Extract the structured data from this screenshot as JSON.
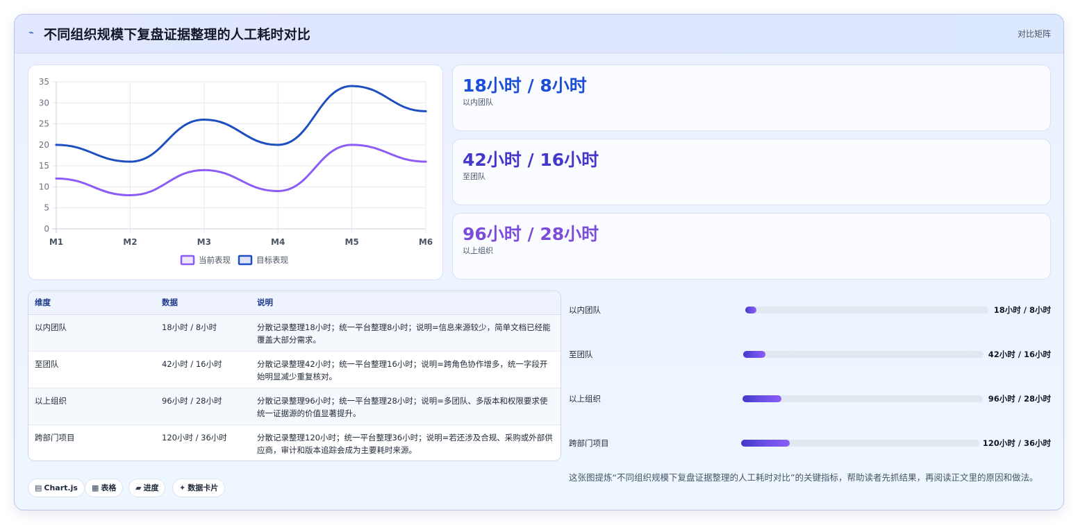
{
  "header": {
    "title": "不同组织规模下复盘证据整理的人工耗时对比",
    "badge": "对比矩阵",
    "icon": "pulse-icon"
  },
  "chart_data": {
    "type": "line",
    "categories": [
      "M1",
      "M2",
      "M3",
      "M4",
      "M5",
      "M6"
    ],
    "series": [
      {
        "name": "当前表现",
        "values": [
          12,
          8,
          14,
          9,
          20,
          16
        ],
        "color": "#8b5cf6"
      },
      {
        "name": "目标表现",
        "values": [
          20,
          16,
          26,
          20,
          34,
          28
        ],
        "color": "#1e4fc2"
      }
    ],
    "ylim": [
      0,
      35
    ],
    "yticks": [
      0,
      5,
      10,
      15,
      20,
      25,
      30,
      35
    ],
    "grid": true,
    "legend": "bottom"
  },
  "kpis": [
    {
      "value": "18小时 / 8小时",
      "label": "以内团队",
      "color": "#1d4ed8"
    },
    {
      "value": "42小时 / 16小时",
      "label": "至团队",
      "color": "#4338ca"
    },
    {
      "value": "96小时 / 28小时",
      "label": "以上组织",
      "color": "#7c4ddb"
    }
  ],
  "table": {
    "headers": [
      "维度",
      "数据",
      "说明"
    ],
    "rows": [
      {
        "dim": "以内团队",
        "data": "18小时 / 8小时",
        "desc": "分散记录整理18小时；统一平台整理8小时；说明=信息来源较少，简单文档已经能覆盖大部分需求。"
      },
      {
        "dim": "至团队",
        "data": "42小时 / 16小时",
        "desc": "分散记录整理42小时；统一平台整理16小时；说明=跨角色协作增多，统一字段开始明显减少重复核对。"
      },
      {
        "dim": "以上组织",
        "data": "96小时 / 28小时",
        "desc": "分散记录整理96小时；统一平台整理28小时；说明=多团队、多版本和权限要求使统一证据源的价值显著提升。"
      },
      {
        "dim": "跨部门项目",
        "data": "120小时 / 36小时",
        "desc": "分散记录整理120小时；统一平台整理36小时；说明=若还涉及合规、采购或外部供应商，审计和版本追踪会成为主要耗时来源。"
      }
    ]
  },
  "progress": [
    {
      "label": "以内团队",
      "value_text": "18小时 / 8小时",
      "fraction": 0.047
    },
    {
      "label": "至团队",
      "value_text": "42小时 / 16小时",
      "fraction": 0.092
    },
    {
      "label": "以上组织",
      "value_text": "96小时 / 28小时",
      "fraction": 0.162
    },
    {
      "label": "跨部门项目",
      "value_text": "120小时 / 36小时",
      "fraction": 0.204
    }
  ],
  "chips": [
    {
      "icon": "chart-icon",
      "glyph": "▤",
      "label": "Chart.js"
    },
    {
      "icon": "table-icon",
      "glyph": "▦",
      "label": "表格"
    },
    {
      "icon": "progress-icon",
      "glyph": "▰",
      "label": "进度"
    },
    {
      "icon": "sparkle-icon",
      "glyph": "✦",
      "label": "数据卡片"
    }
  ],
  "summary": "这张图提炼“不同组织规模下复盘证据整理的人工耗时对比”的关键指标，帮助读者先抓结果，再阅读正文里的原因和做法。"
}
